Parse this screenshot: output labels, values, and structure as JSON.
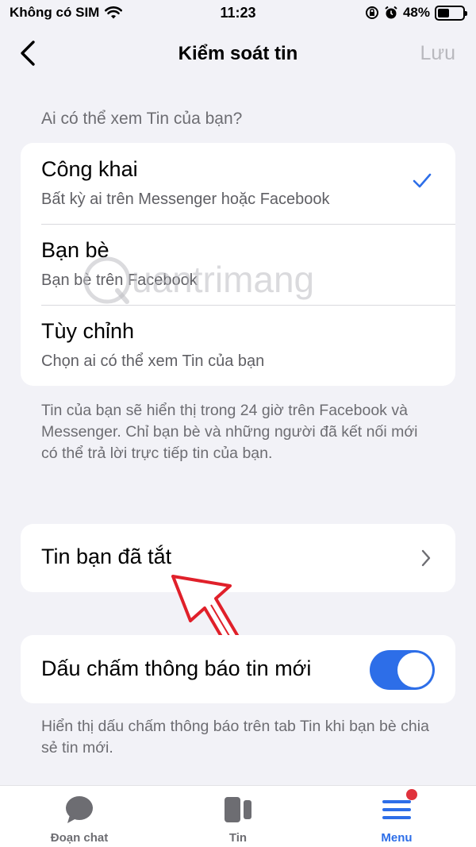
{
  "status_bar": {
    "carrier": "Không có SIM",
    "time": "11:23",
    "battery": "48%",
    "battery_level": 0.48
  },
  "nav": {
    "title": "Kiểm soát tin",
    "save_label": "Lưu"
  },
  "audience": {
    "header": "Ai có thể xem Tin của bạn?",
    "options": [
      {
        "title": "Công khai",
        "subtitle": "Bất kỳ ai trên Messenger hoặc Facebook",
        "selected": true
      },
      {
        "title": "Bạn bè",
        "subtitle": "Bạn bè trên Facebook",
        "selected": false
      },
      {
        "title": "Tùy chỉnh",
        "subtitle": "Chọn ai có thể xem Tin của bạn",
        "selected": false
      }
    ],
    "description": "Tin của bạn sẽ hiển thị trong 24 giờ trên Facebook và Messenger. Chỉ bạn bè và những người đã kết nối mới có thể trả lời trực tiếp tin của bạn."
  },
  "muted": {
    "label": "Tin bạn đã tắt"
  },
  "dot_notification": {
    "label": "Dấu chấm thông báo tin mới",
    "enabled": true,
    "description": "Hiển thị dấu chấm thông báo trên tab Tin khi bạn bè chia sẻ tin mới."
  },
  "watermark": {
    "text": "uantrimang"
  },
  "tabbar": {
    "tabs": [
      {
        "label": "Đoạn chat",
        "icon": "chat-bubble-icon",
        "active": false
      },
      {
        "label": "Tin",
        "icon": "stories-icon",
        "active": false
      },
      {
        "label": "Menu",
        "icon": "menu-icon",
        "active": true,
        "badge": true
      }
    ]
  },
  "colors": {
    "accent": "#2d6ee8",
    "badge": "#e0323c",
    "annotation": "#e0202a",
    "background": "#f2f2f7"
  }
}
